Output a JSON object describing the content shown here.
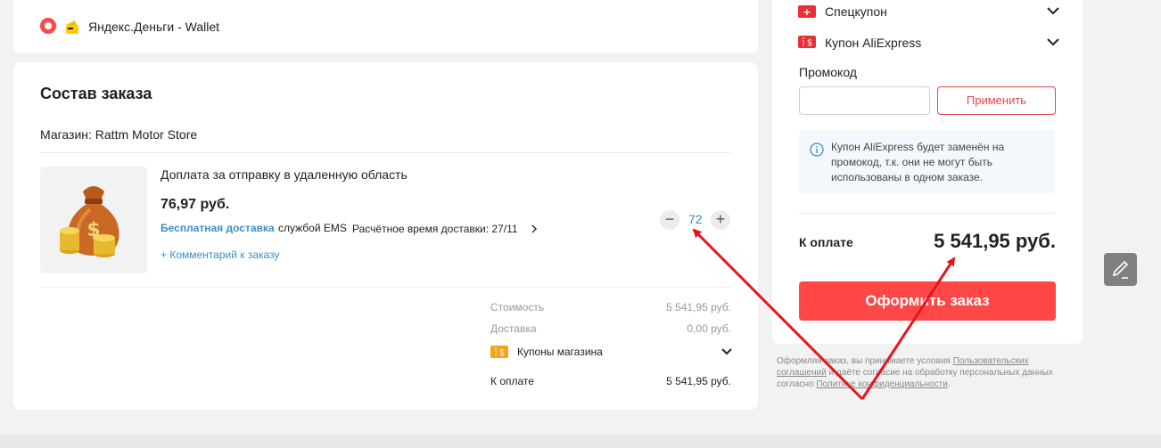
{
  "payment": {
    "wallet_label": "Яндекс.Деньги - Wallet"
  },
  "order": {
    "title": "Состав заказа",
    "store_label": "Магазин: Rattm Motor Store",
    "item": {
      "name": "Доплата за отправку в удаленную область",
      "price": "76,97 руб.",
      "free_shipping": "Бесплатная доставка",
      "carrier": "службой EMS",
      "delivery_time": "Расчётное время доставки: 27/11",
      "comment_link": "+ Комментарий к заказу",
      "quantity": "72"
    },
    "totals": {
      "cost_label": "Стоимость",
      "cost_value": "5 541,95 руб.",
      "shipping_label": "Доставка",
      "shipping_value": "0,00 руб.",
      "store_coupons_label": "Купоны магазина",
      "total_label": "К оплате",
      "total_value": "5 541,95 руб."
    }
  },
  "summary": {
    "special_coupon": "Спецкупон",
    "aliexpress_coupon": "Купон AliExpress",
    "promo_label": "Промокод",
    "promo_placeholder": "",
    "apply_button": "Применить",
    "info_line1": "Купон AliExpress будет заменён на",
    "info_line2": "промокод, т.к. они не могут быть",
    "info_line3": "использованы в одном заказе.",
    "total_label": "К оплате",
    "total_value": "5 541,95 руб.",
    "checkout_button": "Оформить заказ"
  },
  "legal": {
    "text1": "Оформляя заказ, вы принимаете условия ",
    "link1a": "Пользовательских",
    "link1b": "соглашений",
    "text2": " и даёте согласие на обработку персональных данных",
    "text3": "согласно ",
    "link2": "Политике конфиденциальности",
    "text4": "."
  },
  "colors": {
    "accent": "#ff4747",
    "link_blue": "#3a8fc6",
    "annotation_red": "#e8141c"
  },
  "icons": {
    "radio": "radio-selected-icon",
    "wallet": "yandex-money-icon",
    "coupon": "coupon-ticket-icon",
    "chevron": "chevron-down-icon",
    "info": "info-circle-icon",
    "edit": "pencil-edit-icon"
  }
}
